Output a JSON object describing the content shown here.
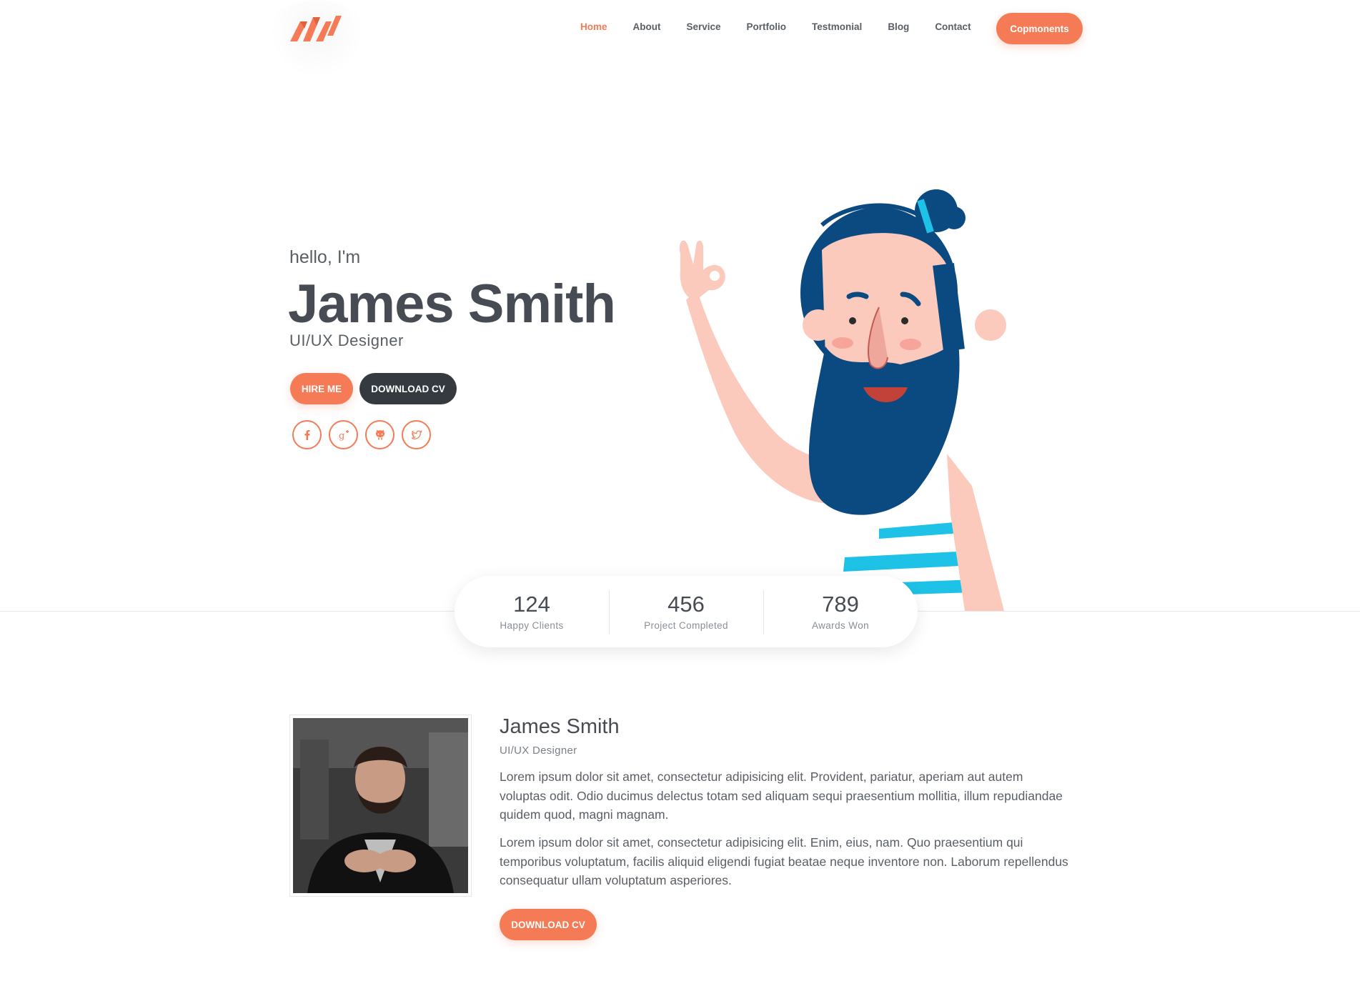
{
  "colors": {
    "accent": "#f47b56",
    "dark": "#353a41",
    "text": "#474c54",
    "beard": "#0b4a80",
    "skin": "#fcc9bd",
    "stripe": "#1ec2e6"
  },
  "nav": {
    "links": [
      {
        "label": "Home"
      },
      {
        "label": "About"
      },
      {
        "label": "Service"
      },
      {
        "label": "Portfolio"
      },
      {
        "label": "Testmonial"
      },
      {
        "label": "Blog"
      },
      {
        "label": "Contact"
      }
    ],
    "cta_label": "Copmonents"
  },
  "hero": {
    "greeting": "hello, I'm",
    "name": "James Smith",
    "role": "UI/UX Designer",
    "hire_label": "HIRE ME",
    "download_label": "DOWNLOAD CV",
    "socials": [
      "facebook-icon",
      "google-plus-icon",
      "github-icon",
      "twitter-icon"
    ]
  },
  "stats": [
    {
      "value": "124",
      "label": "Happy Clients"
    },
    {
      "value": "456",
      "label": "Project Completed"
    },
    {
      "value": "789",
      "label": "Awards Won"
    }
  ],
  "about": {
    "name": "James Smith",
    "role": "UI/UX Designer",
    "p1": "Lorem ipsum dolor sit amet, consectetur adipisicing elit. Provident, pariatur, aperiam aut autem voluptas odit. Odio ducimus delectus totam sed aliquam sequi praesentium mollitia, illum repudiandae quidem quod, magni magnam.",
    "p2": "Lorem ipsum dolor sit amet, consectetur adipisicing elit. Enim, eius, nam. Quo praesentium qui temporibus voluptatum, facilis aliquid eligendi fugiat beatae neque inventore non. Laborum repellendus consequatur ullam voluptatum asperiores.",
    "download_label": "DOWNLOAD CV"
  }
}
